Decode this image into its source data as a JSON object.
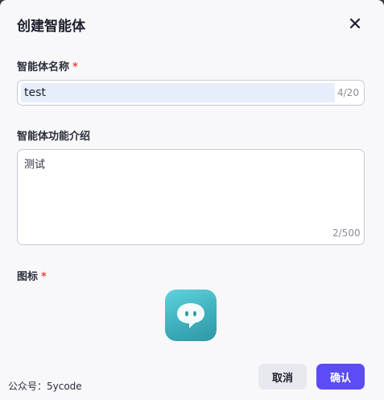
{
  "dialog": {
    "title": "创建智能体",
    "close_icon": "close-icon"
  },
  "name_field": {
    "label": "智能体名称",
    "required_mark": "*",
    "value": "test",
    "counter": "4/20"
  },
  "description_field": {
    "label": "智能体功能介绍",
    "value": "测试",
    "counter": "2/500"
  },
  "icon_field": {
    "label": "图标",
    "required_mark": "*",
    "icon": "chat-bubble-icon",
    "colors": {
      "tile_top": "#5fd3dc",
      "tile_bottom": "#2f97a6"
    }
  },
  "footer": {
    "note": "公众号：5ycode",
    "cancel_label": "取消",
    "confirm_label": "确认"
  },
  "colors": {
    "accent": "#5b4cf5",
    "required": "#f0453b"
  }
}
